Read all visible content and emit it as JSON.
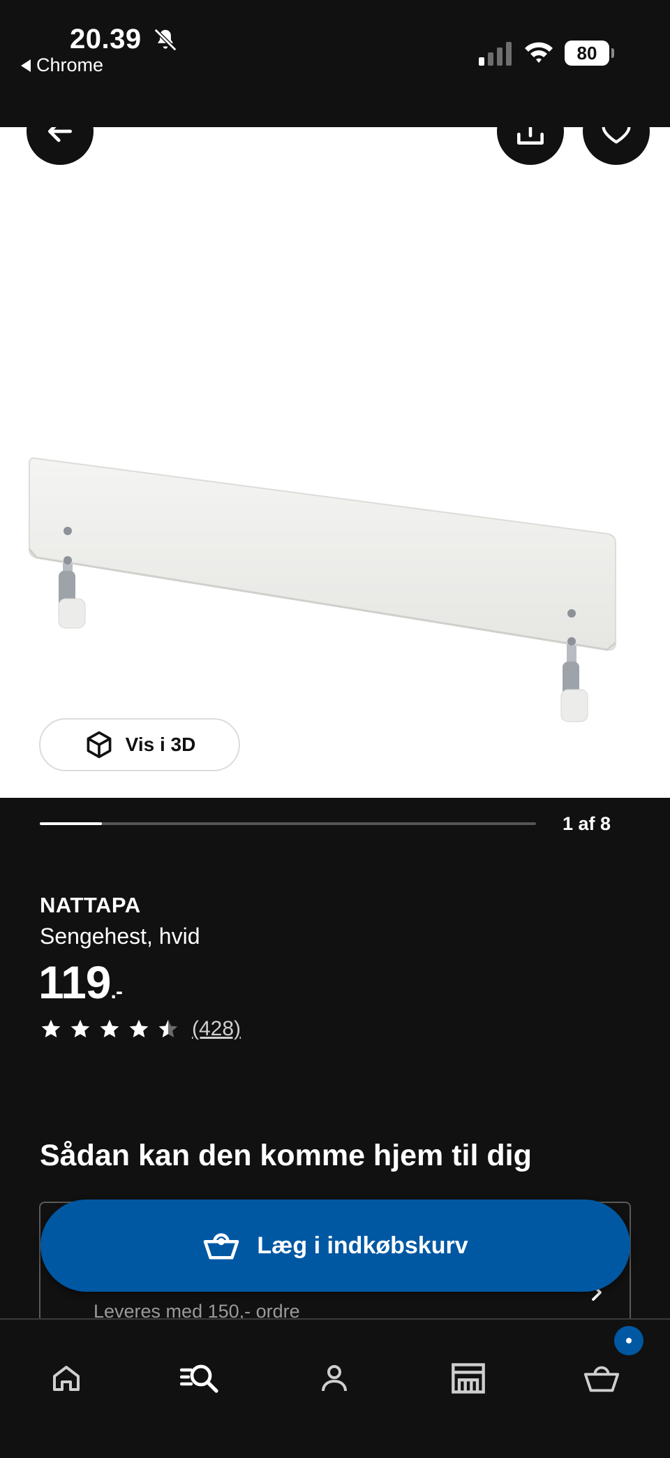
{
  "status_bar": {
    "time": "20.39",
    "back_app_label": "Chrome",
    "battery": "80"
  },
  "gallery": {
    "view_3d_label": "Vis i 3D",
    "page_indicator": "1 af 8",
    "progress_fraction": 0.125
  },
  "product": {
    "name": "NATTAPA",
    "description": "Sengehest, hvid",
    "price": "119",
    "price_suffix": ".-",
    "rating": 4.5,
    "review_count": "(428)"
  },
  "delivery": {
    "heading": "Sådan kan den komme hjem til dig",
    "note": "Leveres med 150,- ordre"
  },
  "actions": {
    "add_to_cart_label": "Læg i indkøbskurv"
  },
  "icons": {
    "back": "arrow-left-icon",
    "share": "share-icon",
    "favorite": "heart-icon",
    "view_3d": "cube-icon",
    "cart": "basket-icon"
  },
  "colors": {
    "background": "#111111",
    "accent": "#0058a3",
    "surface": "#ffffff"
  },
  "bottom_nav": {
    "items": [
      "home",
      "search",
      "profile",
      "store",
      "cart"
    ]
  }
}
